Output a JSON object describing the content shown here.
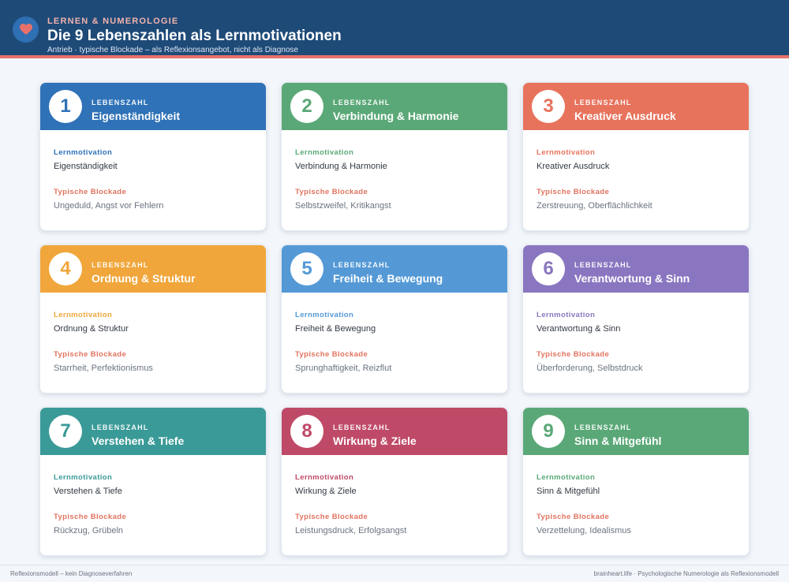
{
  "header": {
    "kicker": "LERNEN & NUMEROLOGIE",
    "title": "Die 9 Lebenszahlen als Lernmotivationen",
    "subtitle": "Antrieb · typische Blockade – als Reflexionsangebot, nicht als Diagnose",
    "icon": "heart-icon",
    "colors": {
      "bar": "#1e4a78",
      "accent_line": "#e8706a",
      "kicker": "#f4b3ac",
      "icon_bg": "#2f6fb3",
      "heart": "#e8706a"
    }
  },
  "cards": [
    {
      "number": "1",
      "kicker": "LEBENSZAHL",
      "title": "Eigenständigkeit",
      "motivation_label": "Lernmotivation",
      "motivation": "Eigenständigkeit",
      "blockade_label": "Typische Blockade",
      "blockade": "Ungeduld, Angst vor Fehlern",
      "color": "#2f72b7"
    },
    {
      "number": "2",
      "kicker": "LEBENSZAHL",
      "title": "Verbindung & Harmonie",
      "motivation_label": "Lernmotivation",
      "motivation": "Verbindung & Harmonie",
      "blockade_label": "Typische Blockade",
      "blockade": "Selbstzweifel, Kritikangst",
      "color": "#5aa877"
    },
    {
      "number": "3",
      "kicker": "LEBENSZAHL",
      "title": "Kreativer Ausdruck",
      "motivation_label": "Lernmotivation",
      "motivation": "Kreativer Ausdruck",
      "blockade_label": "Typische Blockade",
      "blockade": "Zerstreuung, Oberflächlichkeit",
      "color": "#e8735d"
    },
    {
      "number": "4",
      "kicker": "LEBENSZAHL",
      "title": "Ordnung & Struktur",
      "motivation_label": "Lernmotivation",
      "motivation": "Ordnung & Struktur",
      "blockade_label": "Typische Blockade",
      "blockade": "Starrheit, Perfektionismus",
      "color": "#f0a63a"
    },
    {
      "number": "5",
      "kicker": "LEBENSZAHL",
      "title": "Freiheit & Bewegung",
      "motivation_label": "Lernmotivation",
      "motivation": "Freiheit & Bewegung",
      "blockade_label": "Typische Blockade",
      "blockade": "Sprunghaftigkeit, Reizflut",
      "color": "#5499d6"
    },
    {
      "number": "6",
      "kicker": "LEBENSZAHL",
      "title": "Verantwortung & Sinn",
      "motivation_label": "Lernmotivation",
      "motivation": "Verantwortung & Sinn",
      "blockade_label": "Typische Blockade",
      "blockade": "Überforderung, Selbstdruck",
      "color": "#8a76c0"
    },
    {
      "number": "7",
      "kicker": "LEBENSZAHL",
      "title": "Verstehen & Tiefe",
      "motivation_label": "Lernmotivation",
      "motivation": "Verstehen & Tiefe",
      "blockade_label": "Typische Blockade",
      "blockade": "Rückzug, Grübeln",
      "color": "#3a9a98"
    },
    {
      "number": "8",
      "kicker": "LEBENSZAHL",
      "title": "Wirkung & Ziele",
      "motivation_label": "Lernmotivation",
      "motivation": "Wirkung & Ziele",
      "blockade_label": "Typische Blockade",
      "blockade": "Leistungsdruck, Erfolgsangst",
      "color": "#bf4a67"
    },
    {
      "number": "9",
      "kicker": "LEBENSZAHL",
      "title": "Sinn & Mitgefühl",
      "motivation_label": "Lernmotivation",
      "motivation": "Sinn & Mitgefühl",
      "blockade_label": "Typische Blockade",
      "blockade": "Verzettelung, Idealismus",
      "color": "#5aa877"
    }
  ],
  "footer": {
    "left": "Reflexionsmodell – kein Diagnoseverfahren",
    "right": "brainheart.life · Psychologische Numerologie als Reflexionsmodell"
  }
}
